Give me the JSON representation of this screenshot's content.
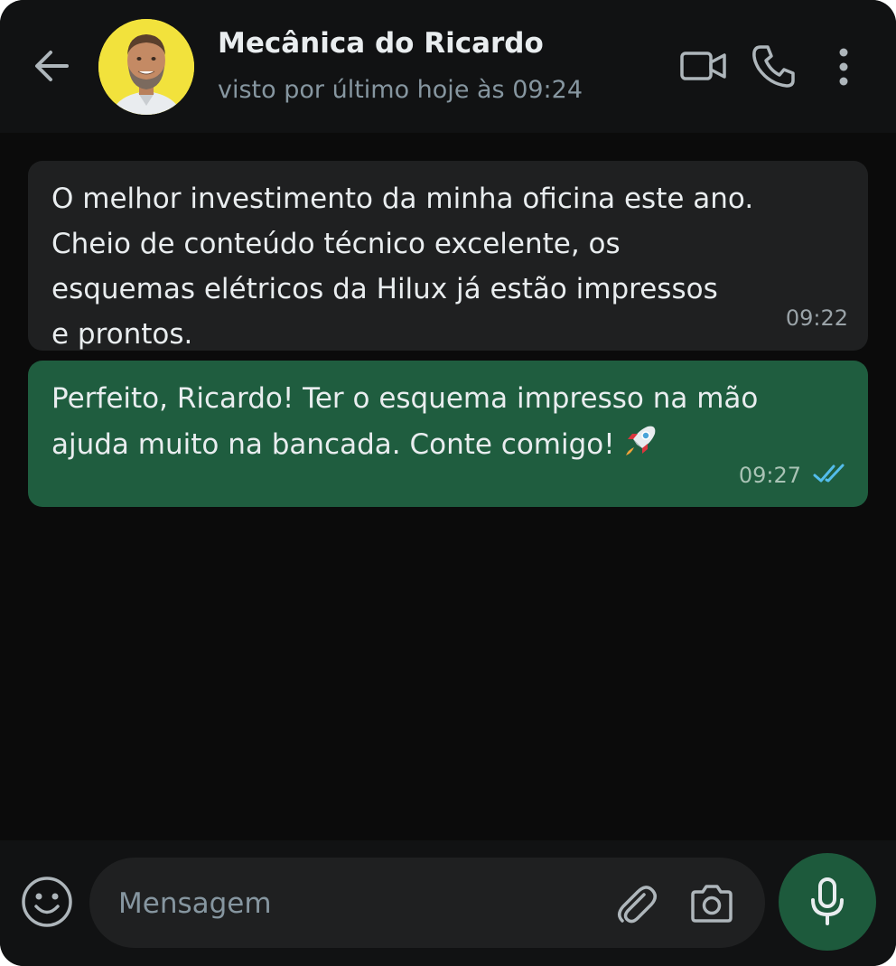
{
  "header": {
    "contact_name": "Mecânica do Ricardo",
    "status": "visto por último hoje às 09:24",
    "icons": [
      "back-arrow-icon",
      "avatar",
      "video-call-icon",
      "phone-call-icon",
      "more-options-icon"
    ]
  },
  "messages": [
    {
      "direction": "incoming",
      "lines": [
        "O melhor investimento da minha oficina este ano.",
        "Cheio de conteúdo técnico excelente, os",
        "esquemas elétricos da Hilux já estão impressos",
        "e prontos."
      ],
      "time": "09:22"
    },
    {
      "direction": "outgoing",
      "lines": [
        "Perfeito, Ricardo! Ter o esquema impresso na mão",
        "ajuda muito na bancada. Conte comigo!"
      ],
      "emoji": "rocket-icon",
      "time": "09:27",
      "status": "read"
    }
  ],
  "composer": {
    "placeholder": "Mensagem",
    "icons": [
      "emoji-icon",
      "attach-icon",
      "camera-icon",
      "microphone-icon"
    ]
  },
  "colors": {
    "background": "#0b0b0b",
    "header": "#111213",
    "incoming_bubble": "#1f2021",
    "outgoing_bubble": "#1f5d3f",
    "mic_button": "#1d5a3c",
    "read_ticks": "#53bdeb",
    "avatar_bg": "#f2e23c"
  }
}
